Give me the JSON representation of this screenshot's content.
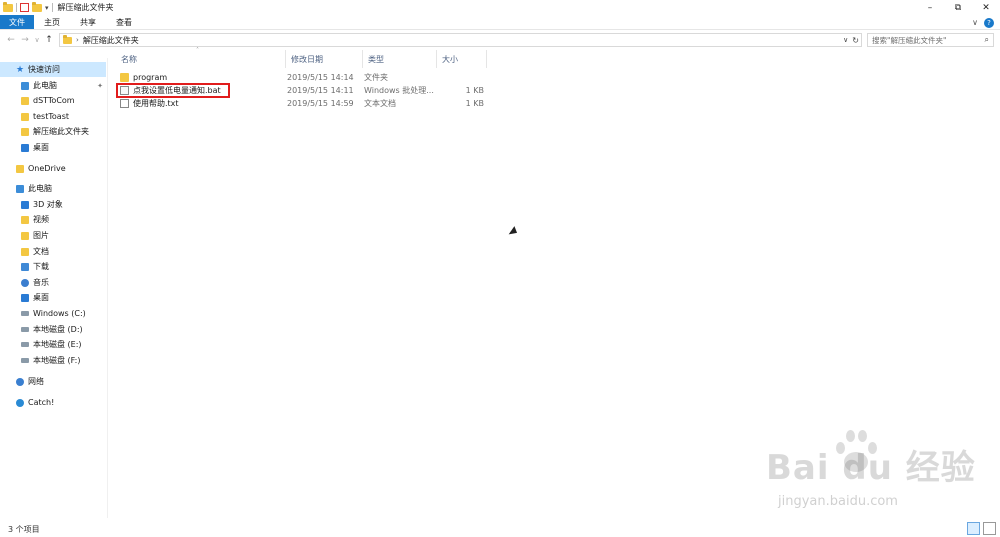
{
  "window": {
    "title": "解压缩此文件夹",
    "controls": {
      "minimize": "–",
      "maximize": "⧉",
      "close": "✕"
    }
  },
  "ribbon": {
    "tabs": [
      "文件",
      "主页",
      "共享",
      "查看"
    ],
    "expand_icon": "chevron-down-icon",
    "help_label": "?"
  },
  "address": {
    "back": "←",
    "forward": "→",
    "recent": "∨",
    "up": "↑",
    "path": [
      "解压缩此文件夹"
    ],
    "dropdown": "∨",
    "refresh": "↻"
  },
  "search": {
    "placeholder": "搜索\"解压缩此文件夹\""
  },
  "sidebar": {
    "items": [
      {
        "label": "快速访问",
        "icon": "star-icon",
        "selected": true
      },
      {
        "label": "此电脑",
        "icon": "pc-icon",
        "pinned": true
      },
      {
        "label": "dSTToCom",
        "icon": "folder-icon"
      },
      {
        "label": "testToast",
        "icon": "folder-icon"
      },
      {
        "label": "解压缩此文件夹",
        "icon": "folder-icon"
      },
      {
        "label": "桌面",
        "icon": "desktop-icon"
      },
      {
        "label": "OneDrive",
        "icon": "folder-icon"
      },
      {
        "label": "此电脑",
        "icon": "pc-icon"
      },
      {
        "label": "3D 对象",
        "icon": "3d-objects-icon"
      },
      {
        "label": "视频",
        "icon": "video-icon"
      },
      {
        "label": "图片",
        "icon": "pictures-icon"
      },
      {
        "label": "文档",
        "icon": "documents-icon"
      },
      {
        "label": "下载",
        "icon": "download-icon"
      },
      {
        "label": "音乐",
        "icon": "music-icon"
      },
      {
        "label": "桌面",
        "icon": "desktop-icon"
      },
      {
        "label": "Windows (C:)",
        "icon": "drive-icon"
      },
      {
        "label": "本地磁盘 (D:)",
        "icon": "drive-icon"
      },
      {
        "label": "本地磁盘 (E:)",
        "icon": "drive-icon"
      },
      {
        "label": "本地磁盘 (F:)",
        "icon": "drive-icon"
      },
      {
        "label": "网络",
        "icon": "network-icon"
      },
      {
        "label": "Catch!",
        "icon": "catch-icon"
      }
    ]
  },
  "list": {
    "columns": [
      "名称",
      "修改日期",
      "类型",
      "大小"
    ],
    "files": [
      {
        "name": "program",
        "date": "2019/5/15 14:14",
        "type": "文件夹",
        "size": "",
        "icon": "folder-icon"
      },
      {
        "name": "点我设置低电量通知.bat",
        "date": "2019/5/15 14:11",
        "type": "Windows 批处理...",
        "size": "1 KB",
        "icon": "batch-file-icon",
        "highlighted": true
      },
      {
        "name": "使用帮助.txt",
        "date": "2019/5/15 14:59",
        "type": "文本文档",
        "size": "1 KB",
        "icon": "text-file-icon"
      }
    ]
  },
  "status": {
    "count": "3 个项目"
  },
  "watermark": {
    "main": "Bai du 经验",
    "sub": "jingyan.baidu.com"
  },
  "colors": {
    "accent": "#1979ca",
    "selection": "#cce8ff",
    "highlight_box": "#e11c1c",
    "header_text": "#4d6182"
  }
}
